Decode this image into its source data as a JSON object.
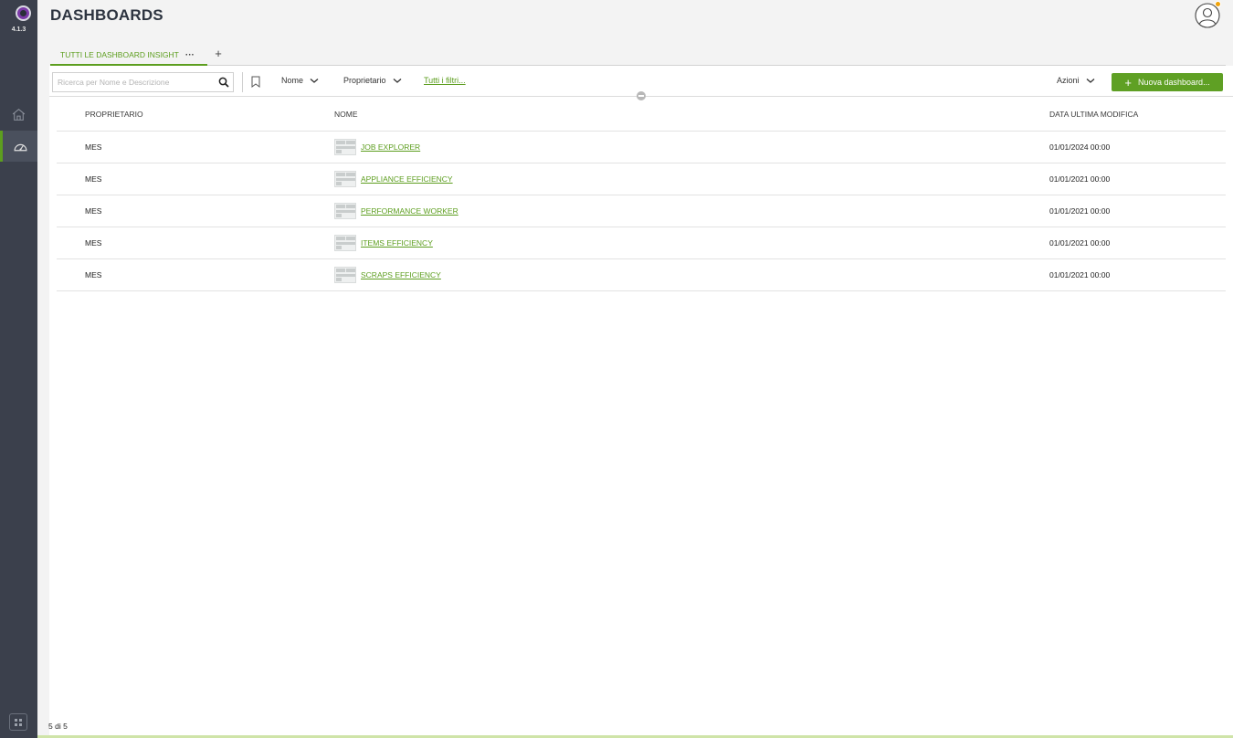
{
  "app": {
    "version": "4.1.3"
  },
  "header": {
    "title": "DASHBOARDS"
  },
  "tabs": [
    {
      "label": "TUTTI LE DASHBOARD INSIGHT",
      "more": "···"
    }
  ],
  "tab_add": "+",
  "toolbar": {
    "search_placeholder": "Ricerca per Nome e Descrizione",
    "filter_nome": "Nome",
    "filter_proprietario": "Proprietario",
    "all_filters": "Tutti i filtri...",
    "azioni": "Azioni",
    "new_dashboard": "Nuova dashboard..."
  },
  "table": {
    "columns": [
      "PROPRIETARIO",
      "NOME",
      "DATA ULTIMA MODIFICA"
    ],
    "rows": [
      {
        "owner": "MES",
        "name": "JOB EXPLORER",
        "date": "01/01/2024 00:00"
      },
      {
        "owner": "MES",
        "name": "APPLIANCE EFFICIENCY",
        "date": "01/01/2021 00:00"
      },
      {
        "owner": "MES",
        "name": "PERFORMANCE WORKER",
        "date": "01/01/2021 00:00"
      },
      {
        "owner": "MES",
        "name": "ITEMS EFFICIENCY",
        "date": "01/01/2021 00:00"
      },
      {
        "owner": "MES",
        "name": "SCRAPS EFFICIENCY",
        "date": "01/01/2021 00:00"
      }
    ]
  },
  "footer": {
    "count": "5 di 5"
  },
  "colors": {
    "accent": "#5fa024",
    "rail": "#3b404c",
    "badge": "#f0a30a"
  },
  "icons": [
    "app-logo-icon",
    "home-icon",
    "dashboard-icon",
    "apps-grid-icon",
    "user-avatar-icon",
    "search-icon",
    "bookmark-icon",
    "chevron-down-icon",
    "plus-icon"
  ]
}
